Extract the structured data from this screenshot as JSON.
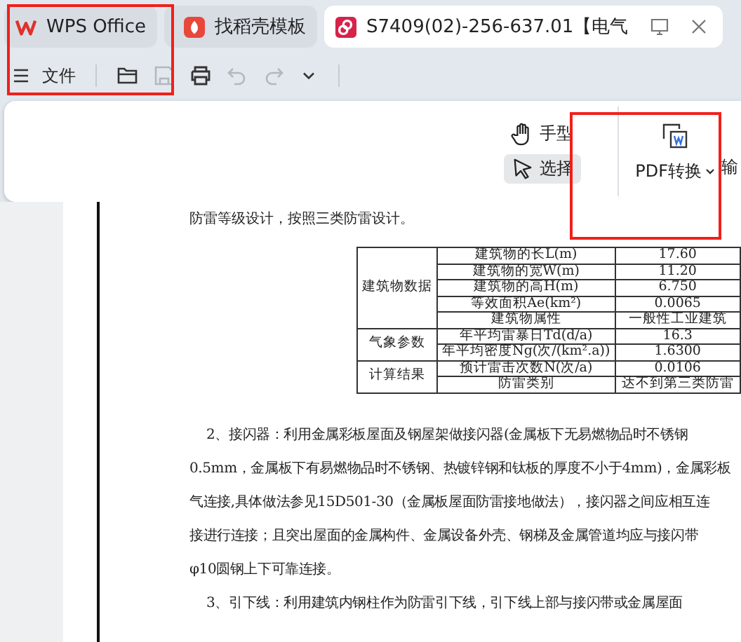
{
  "tabs": [
    {
      "label": "WPS Office",
      "kind": "app",
      "selected": false
    },
    {
      "label": "找稻壳模板",
      "kind": "template",
      "selected": false
    },
    {
      "label": "S7409(02)-256-637.01【电气",
      "kind": "document",
      "selected": true
    }
  ],
  "toolbar": {
    "file_menu": "文件",
    "buttons": [
      {
        "kind": "open",
        "disabled": false
      },
      {
        "kind": "save",
        "disabled": true
      },
      {
        "kind": "print",
        "disabled": false
      },
      {
        "kind": "undo",
        "disabled": true
      },
      {
        "kind": "redo",
        "disabled": true
      },
      {
        "kind": "more",
        "disabled": false
      }
    ]
  },
  "ribbon": {
    "tools": [
      {
        "label": "手型",
        "kind": "hand",
        "selected": false
      },
      {
        "label": "选择",
        "kind": "select",
        "selected": true
      }
    ],
    "convert": {
      "label": "PDF转换"
    },
    "next_label": "输"
  },
  "document": {
    "intro": "防雷等级设计，按照三类防雷设计。",
    "table": {
      "groups": [
        {
          "label": "建筑物数据",
          "rows": [
            {
              "label": "建筑物的长L(m)",
              "value": "17.60"
            },
            {
              "label": "建筑物的宽W(m)",
              "value": "11.20"
            },
            {
              "label": "建筑物的高H(m)",
              "value": "6.750"
            },
            {
              "label": "等效面积Ae(km²)",
              "value": "0.0065"
            },
            {
              "label": "建筑物属性",
              "value": "一般性工业建筑"
            }
          ]
        },
        {
          "label": "气象参数",
          "rows": [
            {
              "label": "年平均雷暴日Td(d/a)",
              "value": "16.3"
            },
            {
              "label": "年平均密度Ng(次/(km².a))",
              "value": "1.6300"
            }
          ]
        },
        {
          "label": "计算结果",
          "rows": [
            {
              "label": "预计雷击次数N(次/a)",
              "value": "0.0106"
            },
            {
              "label": "防雷类别",
              "value": "达不到第三类防雷"
            }
          ]
        }
      ]
    },
    "lines": [
      {
        "text": "2、接闪器：利用金属彩板屋面及钢屋架做接闪器(金属板下无易燃物品时不锈钢",
        "indent": true
      },
      {
        "text": "0.5mm，金属板下有易燃物品时不锈钢、热镀锌钢和钛板的厚度不小于4mm)，金属彩板",
        "indent": false
      },
      {
        "text": "气连接,具体做法参见15D501-30（金属板屋面防雷接地做法），接闪器之间应相互连",
        "indent": false
      },
      {
        "text": "接进行连接；且突出屋面的金属构件、金属设备外壳、钢梯及金属管道均应与接闪带",
        "indent": false
      },
      {
        "text": "φ10圆钢上下可靠连接。",
        "indent": false
      },
      {
        "text": "3、引下线：利用建筑内钢柱作为防雷引下线，引下线上部与接闪带或金属屋面",
        "indent": true
      }
    ]
  }
}
